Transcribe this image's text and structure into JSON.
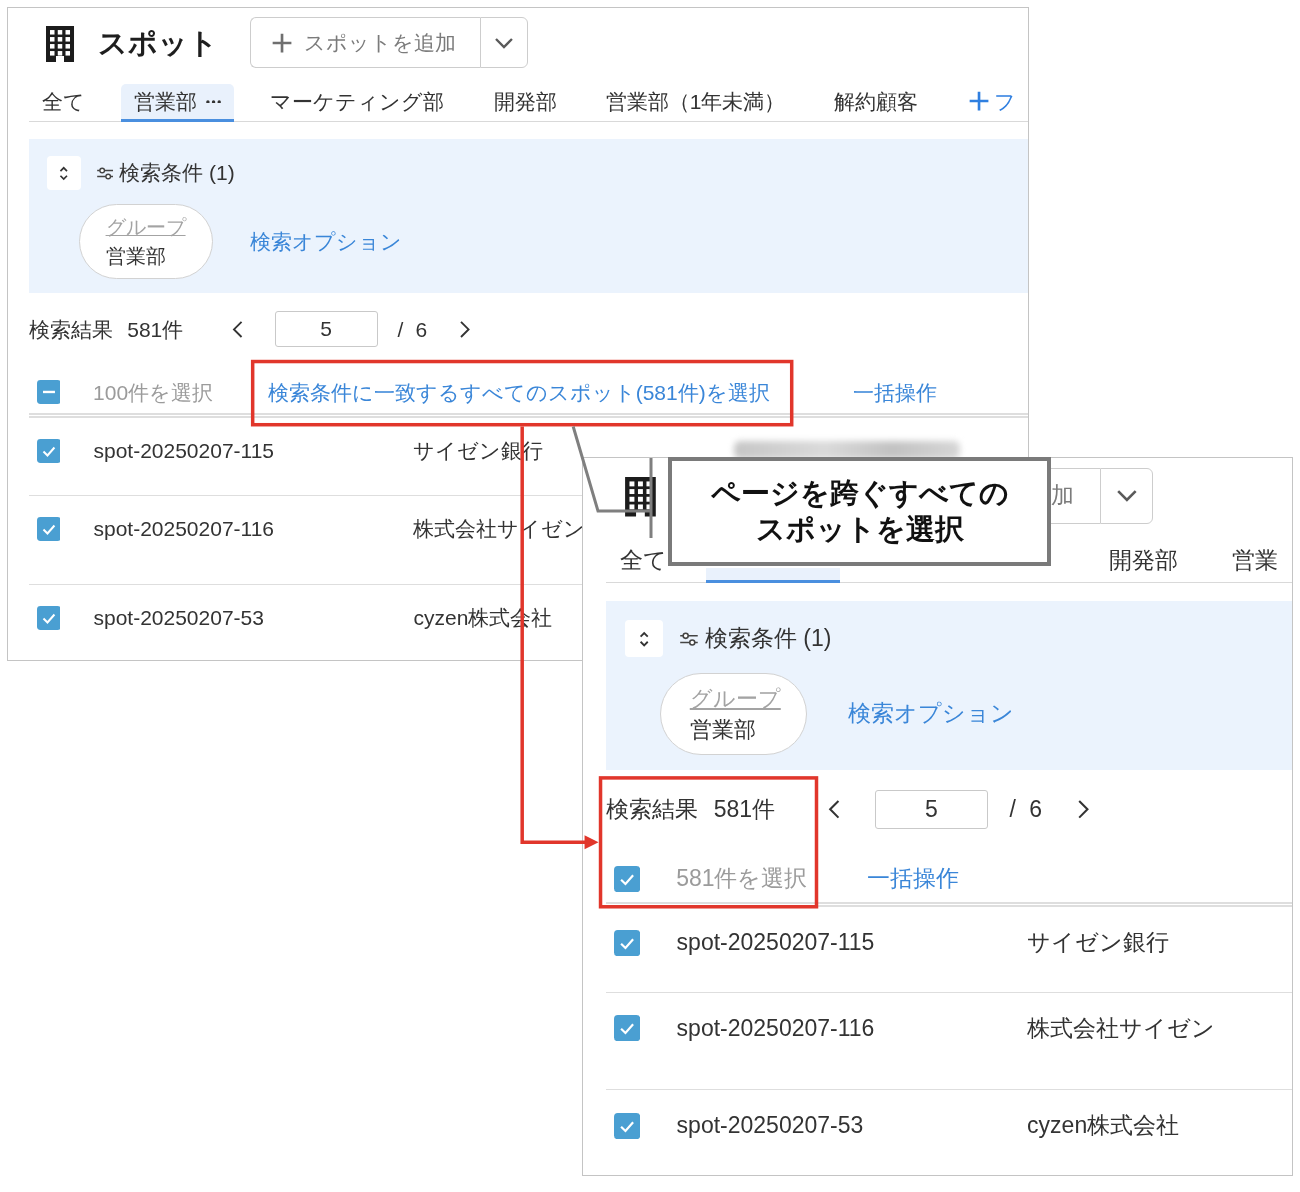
{
  "windows": [
    {
      "header": {
        "title": "スポット",
        "add_button": {
          "label": "スポットを追加"
        }
      },
      "tabs": [
        {
          "label": "全て",
          "selected": false
        },
        {
          "label": "営業部",
          "selected": true
        },
        {
          "label": "マーケティング部",
          "selected": false
        },
        {
          "label": "開発部",
          "selected": false
        },
        {
          "label": "営業部（1年未満）",
          "selected": false
        },
        {
          "label": "解約顧客",
          "selected": false
        }
      ],
      "add_tab": {
        "label": "フ"
      },
      "search": {
        "title": "検索条件 (1)",
        "chip": {
          "key": "グループ",
          "value": "営業部"
        },
        "options_link": "検索オプション"
      },
      "results": {
        "label": "検索結果",
        "count": "581件",
        "page": "5",
        "total": "/ 6"
      },
      "selection": {
        "indeterminate": true,
        "label": "100件を選択",
        "select_all_link": "検索条件に一致するすべてのスポット(581件)を選択",
        "bulk_link": "一括操作"
      },
      "rows": [
        {
          "checked": true,
          "id": "spot-20250207-115",
          "company": "サイゼン銀行",
          "redacted": true
        },
        {
          "checked": true,
          "id": "spot-20250207-116",
          "company": "株式会社サイゼン"
        },
        {
          "checked": true,
          "id": "spot-20250207-53",
          "company": "cyzen株式会社"
        }
      ]
    },
    {
      "header": {
        "add_button": {
          "label": "加",
          "covered": true
        }
      },
      "tabs": [
        {
          "label": "全て",
          "selected": false
        },
        {
          "selected": true
        },
        {
          "label": "開発部",
          "selected": false
        },
        {
          "label": "営業",
          "selected": false
        }
      ],
      "search": {
        "title": "検索条件 (1)",
        "chip": {
          "key": "グループ",
          "value": "営業部"
        },
        "options_link": "検索オプション"
      },
      "results": {
        "label": "検索結果",
        "count": "581件",
        "page": "5",
        "total": "/ 6"
      },
      "selection": {
        "checked": true,
        "label": "581件を選択",
        "bulk_link": "一括操作"
      },
      "rows": [
        {
          "checked": true,
          "id": "spot-20250207-115",
          "company": "サイゼン銀行"
        },
        {
          "checked": true,
          "id": "spot-20250207-116",
          "company": "株式会社サイゼン"
        },
        {
          "checked": true,
          "id": "spot-20250207-53",
          "company": "cyzen株式会社"
        }
      ]
    }
  ],
  "callout": {
    "text": "ページを跨ぐすべてのスポットを選択"
  }
}
